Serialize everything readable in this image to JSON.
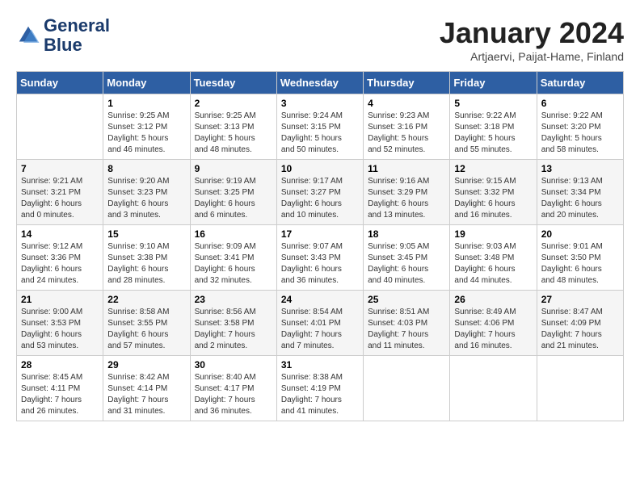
{
  "header": {
    "logo_line1": "General",
    "logo_line2": "Blue",
    "month": "January 2024",
    "location": "Artjaervi, Paijat-Hame, Finland"
  },
  "days_of_week": [
    "Sunday",
    "Monday",
    "Tuesday",
    "Wednesday",
    "Thursday",
    "Friday",
    "Saturday"
  ],
  "weeks": [
    [
      {
        "day": "",
        "info": ""
      },
      {
        "day": "1",
        "info": "Sunrise: 9:25 AM\nSunset: 3:12 PM\nDaylight: 5 hours\nand 46 minutes."
      },
      {
        "day": "2",
        "info": "Sunrise: 9:25 AM\nSunset: 3:13 PM\nDaylight: 5 hours\nand 48 minutes."
      },
      {
        "day": "3",
        "info": "Sunrise: 9:24 AM\nSunset: 3:15 PM\nDaylight: 5 hours\nand 50 minutes."
      },
      {
        "day": "4",
        "info": "Sunrise: 9:23 AM\nSunset: 3:16 PM\nDaylight: 5 hours\nand 52 minutes."
      },
      {
        "day": "5",
        "info": "Sunrise: 9:22 AM\nSunset: 3:18 PM\nDaylight: 5 hours\nand 55 minutes."
      },
      {
        "day": "6",
        "info": "Sunrise: 9:22 AM\nSunset: 3:20 PM\nDaylight: 5 hours\nand 58 minutes."
      }
    ],
    [
      {
        "day": "7",
        "info": "Sunrise: 9:21 AM\nSunset: 3:21 PM\nDaylight: 6 hours\nand 0 minutes."
      },
      {
        "day": "8",
        "info": "Sunrise: 9:20 AM\nSunset: 3:23 PM\nDaylight: 6 hours\nand 3 minutes."
      },
      {
        "day": "9",
        "info": "Sunrise: 9:19 AM\nSunset: 3:25 PM\nDaylight: 6 hours\nand 6 minutes."
      },
      {
        "day": "10",
        "info": "Sunrise: 9:17 AM\nSunset: 3:27 PM\nDaylight: 6 hours\nand 10 minutes."
      },
      {
        "day": "11",
        "info": "Sunrise: 9:16 AM\nSunset: 3:29 PM\nDaylight: 6 hours\nand 13 minutes."
      },
      {
        "day": "12",
        "info": "Sunrise: 9:15 AM\nSunset: 3:32 PM\nDaylight: 6 hours\nand 16 minutes."
      },
      {
        "day": "13",
        "info": "Sunrise: 9:13 AM\nSunset: 3:34 PM\nDaylight: 6 hours\nand 20 minutes."
      }
    ],
    [
      {
        "day": "14",
        "info": "Sunrise: 9:12 AM\nSunset: 3:36 PM\nDaylight: 6 hours\nand 24 minutes."
      },
      {
        "day": "15",
        "info": "Sunrise: 9:10 AM\nSunset: 3:38 PM\nDaylight: 6 hours\nand 28 minutes."
      },
      {
        "day": "16",
        "info": "Sunrise: 9:09 AM\nSunset: 3:41 PM\nDaylight: 6 hours\nand 32 minutes."
      },
      {
        "day": "17",
        "info": "Sunrise: 9:07 AM\nSunset: 3:43 PM\nDaylight: 6 hours\nand 36 minutes."
      },
      {
        "day": "18",
        "info": "Sunrise: 9:05 AM\nSunset: 3:45 PM\nDaylight: 6 hours\nand 40 minutes."
      },
      {
        "day": "19",
        "info": "Sunrise: 9:03 AM\nSunset: 3:48 PM\nDaylight: 6 hours\nand 44 minutes."
      },
      {
        "day": "20",
        "info": "Sunrise: 9:01 AM\nSunset: 3:50 PM\nDaylight: 6 hours\nand 48 minutes."
      }
    ],
    [
      {
        "day": "21",
        "info": "Sunrise: 9:00 AM\nSunset: 3:53 PM\nDaylight: 6 hours\nand 53 minutes."
      },
      {
        "day": "22",
        "info": "Sunrise: 8:58 AM\nSunset: 3:55 PM\nDaylight: 6 hours\nand 57 minutes."
      },
      {
        "day": "23",
        "info": "Sunrise: 8:56 AM\nSunset: 3:58 PM\nDaylight: 7 hours\nand 2 minutes."
      },
      {
        "day": "24",
        "info": "Sunrise: 8:54 AM\nSunset: 4:01 PM\nDaylight: 7 hours\nand 7 minutes."
      },
      {
        "day": "25",
        "info": "Sunrise: 8:51 AM\nSunset: 4:03 PM\nDaylight: 7 hours\nand 11 minutes."
      },
      {
        "day": "26",
        "info": "Sunrise: 8:49 AM\nSunset: 4:06 PM\nDaylight: 7 hours\nand 16 minutes."
      },
      {
        "day": "27",
        "info": "Sunrise: 8:47 AM\nSunset: 4:09 PM\nDaylight: 7 hours\nand 21 minutes."
      }
    ],
    [
      {
        "day": "28",
        "info": "Sunrise: 8:45 AM\nSunset: 4:11 PM\nDaylight: 7 hours\nand 26 minutes."
      },
      {
        "day": "29",
        "info": "Sunrise: 8:42 AM\nSunset: 4:14 PM\nDaylight: 7 hours\nand 31 minutes."
      },
      {
        "day": "30",
        "info": "Sunrise: 8:40 AM\nSunset: 4:17 PM\nDaylight: 7 hours\nand 36 minutes."
      },
      {
        "day": "31",
        "info": "Sunrise: 8:38 AM\nSunset: 4:19 PM\nDaylight: 7 hours\nand 41 minutes."
      },
      {
        "day": "",
        "info": ""
      },
      {
        "day": "",
        "info": ""
      },
      {
        "day": "",
        "info": ""
      }
    ]
  ]
}
